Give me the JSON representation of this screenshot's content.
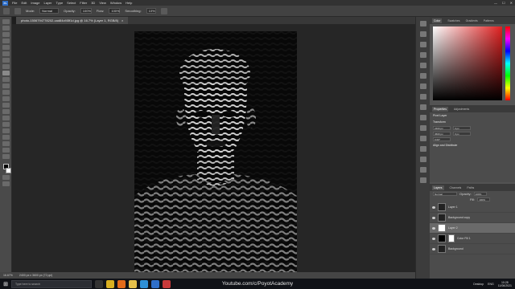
{
  "menu": [
    "File",
    "Edit",
    "Image",
    "Layer",
    "Type",
    "Select",
    "Filter",
    "3D",
    "View",
    "Window",
    "Help"
  ],
  "options": {
    "mode_label": "Mode:",
    "mode_value": "Normal",
    "opacity_label": "Opacity:",
    "opacity_value": "100%",
    "flow_label": "Flow:",
    "flow_value": "100%",
    "smoothing_label": "Smoothing:",
    "smoothing_value": "10%"
  },
  "document_tab": {
    "title": "photo-1506794778202-cad84cf45f1d.jpg @ 16.7% (Layer 1, RGB/8)",
    "close": "×"
  },
  "panels": {
    "color_tabs": [
      "Color",
      "Swatches",
      "Gradients",
      "Patterns"
    ],
    "properties_tabs": [
      "Properties",
      "Adjustments"
    ],
    "props_type": "Pixel Layer",
    "transform_title": "Transform",
    "w": "2400 px",
    "h": "3600 px",
    "x": "0 px",
    "y": "0 px",
    "angle": "0.00°",
    "align_title": "Align and Distribute",
    "layers_tabs": [
      "Layers",
      "Channels",
      "Paths"
    ],
    "blend": "Normal",
    "opacity_label": "Opacity:",
    "opacity": "100%",
    "fill_label": "Fill:",
    "fill": "100%",
    "layers": [
      {
        "name": "Layer 1"
      },
      {
        "name": "Background copy"
      },
      {
        "name": "Layer 2"
      },
      {
        "name": "Color Fill 1"
      },
      {
        "name": "Background"
      }
    ]
  },
  "status": {
    "zoom": "16.67%",
    "size": "2400 px x 3600 px (72 ppi)"
  },
  "taskbar": {
    "search": "Type here to search",
    "watermark": "Youtube.com/c/PoyotAcademy",
    "desktop": "Desktop",
    "lang": "ENG",
    "time": "10:28",
    "date": "11/06/2021"
  },
  "colors": {
    "accent": "#2f6fc9",
    "panel": "#535353",
    "canvas_bg": "#262626"
  }
}
